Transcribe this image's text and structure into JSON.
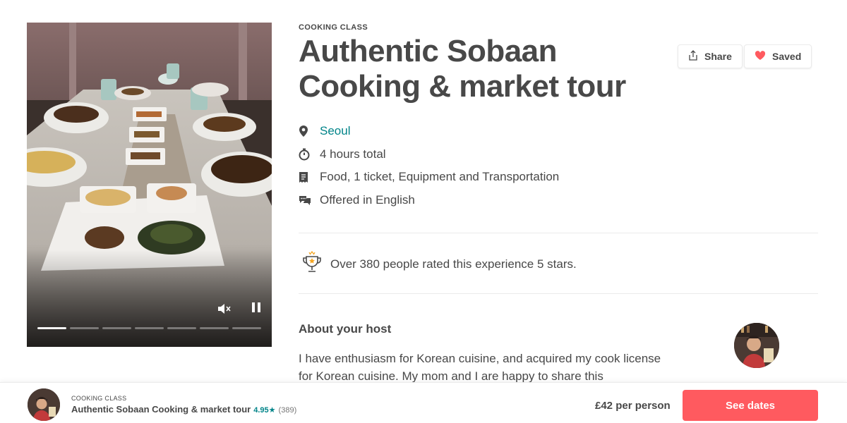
{
  "experience": {
    "category": "COOKING CLASS",
    "title": "Authentic Sobaan Cooking & market tour"
  },
  "actions": {
    "share_label": "Share",
    "saved_label": "Saved"
  },
  "details": {
    "location": "Seoul",
    "duration": "4 hours total",
    "includes": "Food, 1 ticket, Equipment and Transportation",
    "language": "Offered in English"
  },
  "rating_banner": {
    "text": "Over 380 people rated this experience 5 stars."
  },
  "host": {
    "heading": "About your host",
    "bio": "I have enthusiasm for Korean cuisine, and acquired my cook license for Korean cuisine. My mom and I are happy to share this"
  },
  "media": {
    "segments_total": 7,
    "active_segment": 1
  },
  "bottom_bar": {
    "category": "COOKING CLASS",
    "title": "Authentic Sobaan Cooking & market tour",
    "rating": "4.95",
    "star": "★",
    "review_count": "(389)",
    "price": "£42 per person",
    "cta_label": "See dates"
  },
  "colors": {
    "accent": "#ff5a5f",
    "link": "#008489",
    "text": "#484848",
    "heart": "#ff5a5f"
  },
  "icons": {
    "location": "map-pin-icon",
    "duration": "stopwatch-icon",
    "includes": "receipt-list-icon",
    "language": "chat-bubbles-icon",
    "rating": "trophy-icon",
    "share": "share-icon",
    "saved": "heart-icon",
    "mute": "mute-icon",
    "pause": "pause-icon"
  }
}
